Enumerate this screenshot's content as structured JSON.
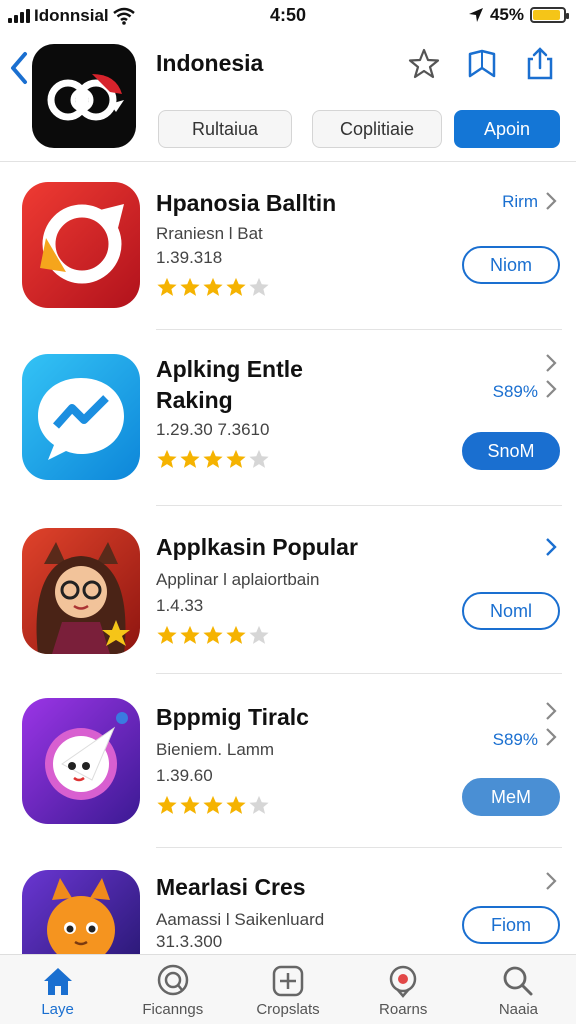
{
  "status_bar": {
    "carrier": "Idonnsial",
    "time": "4:50",
    "battery_percent": "45%",
    "battery_level": 0.9
  },
  "header": {
    "title": "Indonesia",
    "icons": [
      "back-chevron-icon",
      "star-icon",
      "bookmark-icon",
      "share-icon"
    ],
    "segments": [
      {
        "label": "Rultaiua",
        "selected": false
      },
      {
        "label": "Coplitiaie",
        "selected": false
      },
      {
        "label": "Apoin",
        "selected": true
      }
    ]
  },
  "apps": [
    {
      "name_lines": [
        "Hpanosia Balltin"
      ],
      "subtitle": "Rraniesn l Bat",
      "number": "1.39.318",
      "rating": 4,
      "meta": "Rirm",
      "button": "Niom",
      "button_style": "outline",
      "icon": "refresh-arrow-icon",
      "icon_colors": [
        "#e3282b",
        "#a3111a"
      ]
    },
    {
      "name_lines": [
        "Aplking Entle",
        "Raking"
      ],
      "subtitle": "",
      "number": "1.29.30 7.3610",
      "rating": 4,
      "meta": "S89%",
      "button": "SnoM",
      "button_style": "filled",
      "icon": "chat-trend-icon",
      "icon_colors": [
        "#2ab7f0",
        "#0f86d6"
      ]
    },
    {
      "name_lines": [
        "Applkasin Popular"
      ],
      "subtitle": "Applinar l aplaiortbain",
      "number": "1.4.33",
      "rating": 4,
      "meta": "",
      "button": "Noml",
      "button_style": "outline",
      "icon": "girl-character-icon",
      "icon_colors": [
        "#d6321f",
        "#8d1410"
      ]
    },
    {
      "name_lines": [
        "Bppmig Tiralc"
      ],
      "subtitle": "Bieniem. Lamm",
      "number": "1.39.60",
      "rating": 4,
      "meta": "S89%",
      "button": "MeM",
      "button_style": "filled-muted",
      "icon": "ghost-character-icon",
      "icon_colors": [
        "#8a2be2",
        "#3b1a8f"
      ]
    },
    {
      "name_lines": [
        "Mearlasi Cres"
      ],
      "subtitle": "Aamassi l Saikenluard",
      "number": "31.3.300",
      "rating": 4,
      "meta": "",
      "button": "Fiom",
      "button_style": "outline",
      "icon": "fox-character-icon",
      "icon_colors": [
        "#5a2fc2",
        "#2d1a7a"
      ]
    }
  ],
  "tab_bar": [
    {
      "label": "Laye",
      "icon": "home-icon",
      "active": true
    },
    {
      "label": "Ficanngs",
      "icon": "magnify-circle-icon",
      "active": false
    },
    {
      "label": "Cropslats",
      "icon": "add-box-icon",
      "active": false
    },
    {
      "label": "Roarns",
      "icon": "location-pin-icon",
      "active": false
    },
    {
      "label": "Naaia",
      "icon": "search-icon",
      "active": false
    }
  ],
  "colors": {
    "accent": "#1a6fd0",
    "star": "#f5b301",
    "star_empty": "#d6d6d6"
  }
}
